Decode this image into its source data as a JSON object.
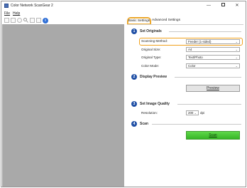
{
  "window": {
    "title": "Color Network ScanGear 2"
  },
  "menu": {
    "items": [
      "File",
      "Help"
    ]
  },
  "tabs": {
    "basic": "Basic Settings",
    "advanced": "Advanced Settings"
  },
  "sections": {
    "originals": {
      "num": "1",
      "title": "Set Originals",
      "scanning_method_label": "Scanning Method:",
      "scanning_method_value": "Feeder (1-sided)",
      "original_size_label": "Original Size:",
      "original_size_value": "A4",
      "original_type_label": "Original Type:",
      "original_type_value": "Text/Photo",
      "color_mode_label": "Color Mode:",
      "color_mode_value": "Color"
    },
    "preview": {
      "num": "2",
      "title": "Display Preview",
      "button": "Preview"
    },
    "quality": {
      "num": "3",
      "title": "Set Image Quality",
      "resolution_label": "Resolution:",
      "resolution_value": "200",
      "resolution_unit": "dpi"
    },
    "scan": {
      "num": "4",
      "title": "Scan",
      "button": "Scan"
    }
  },
  "colors": {
    "accent": "#1f4fa5",
    "highlight": "#f0a21e",
    "scan_button": "#4cc23a",
    "preview_bg": "#a9a9a9"
  },
  "icons": [
    "new-page-icon",
    "blank-page-icon",
    "rotate-icon",
    "zoom-icon",
    "copy-icon",
    "copy-alt-icon",
    "info-icon"
  ]
}
